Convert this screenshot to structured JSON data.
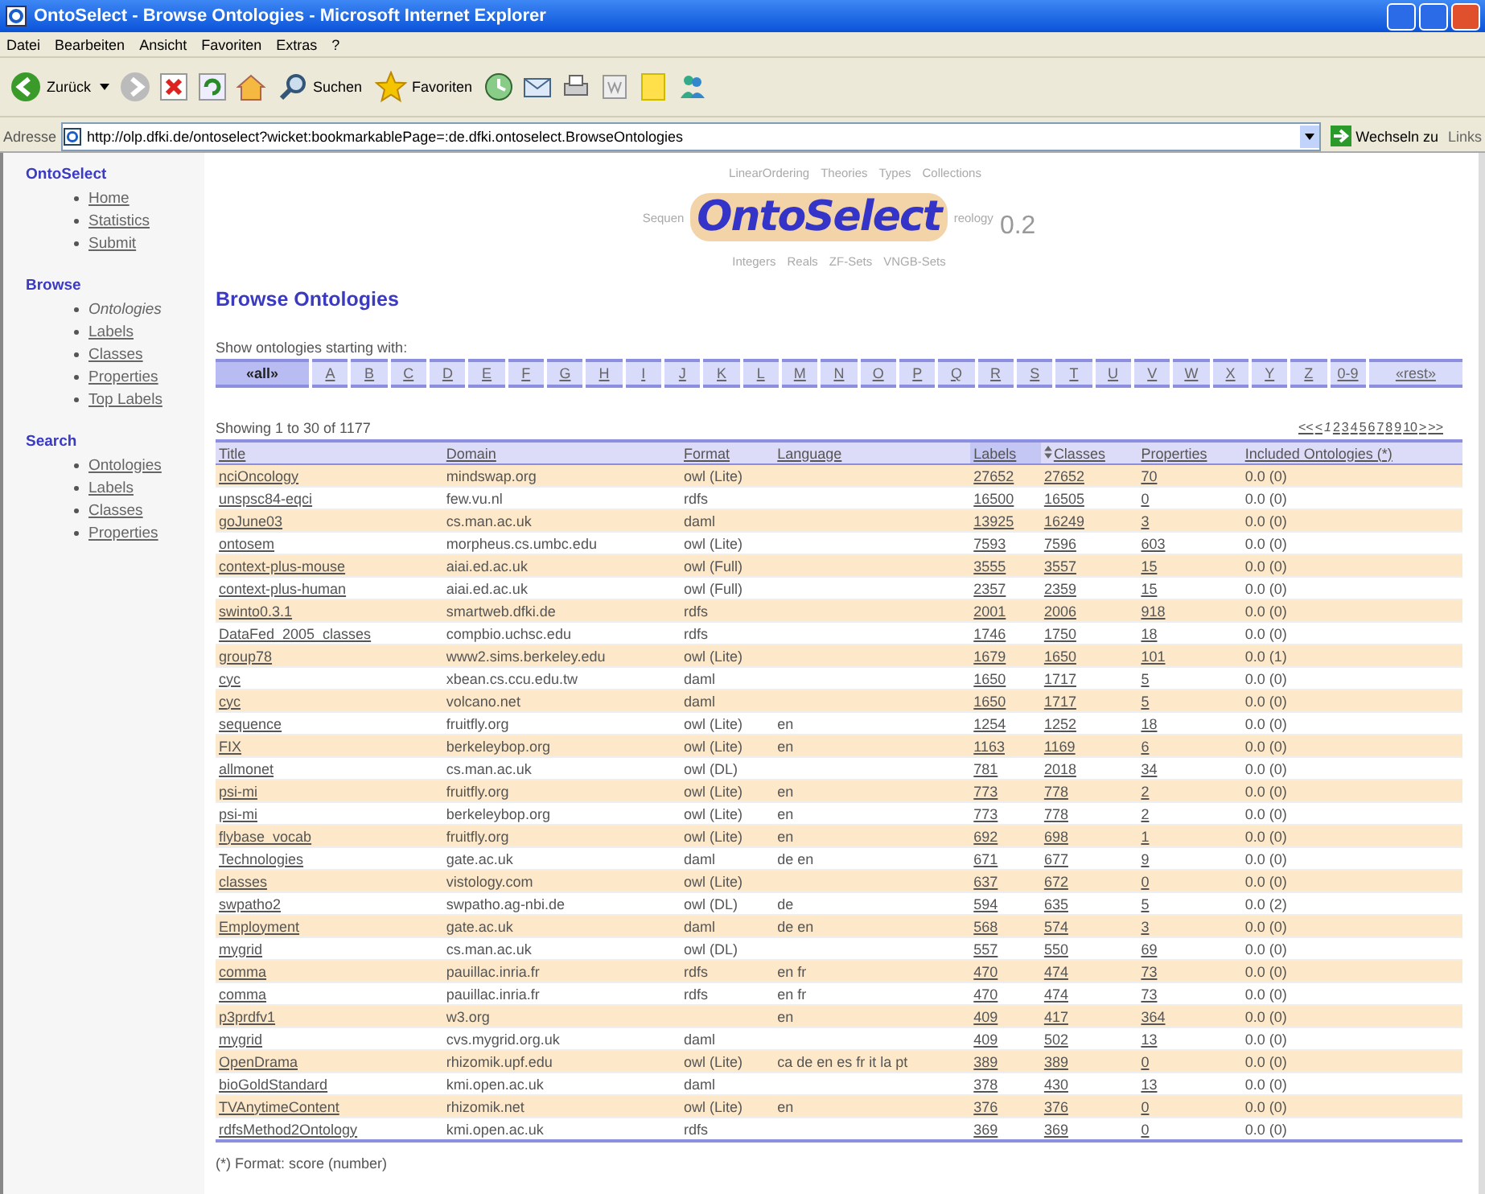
{
  "window": {
    "title": "OntoSelect - Browse Ontologies - Microsoft Internet Explorer"
  },
  "menu": [
    "Datei",
    "Bearbeiten",
    "Ansicht",
    "Favoriten",
    "Extras",
    "?"
  ],
  "toolbar": {
    "back": "Zurück",
    "search": "Suchen",
    "favorites": "Favoriten"
  },
  "address_bar": {
    "label": "Adresse",
    "url": "http://olp.dfki.de/ontoselect?wicket:bookmarkablePage=:de.dfki.ontoselect.BrowseOntologies",
    "go": "Wechseln zu",
    "links": "Links"
  },
  "sidebar": [
    {
      "heading": "OntoSelect",
      "items": [
        {
          "label": "Home",
          "selected": false
        },
        {
          "label": "Statistics",
          "selected": false
        },
        {
          "label": "Submit",
          "selected": false
        }
      ]
    },
    {
      "heading": "Browse",
      "items": [
        {
          "label": "Ontologies",
          "selected": true
        },
        {
          "label": "Labels",
          "selected": false
        },
        {
          "label": "Classes",
          "selected": false
        },
        {
          "label": "Properties",
          "selected": false
        },
        {
          "label": "Top Labels",
          "selected": false
        }
      ]
    },
    {
      "heading": "Search",
      "items": [
        {
          "label": "Ontologies",
          "selected": false
        },
        {
          "label": "Labels",
          "selected": false
        },
        {
          "label": "Classes",
          "selected": false
        },
        {
          "label": "Properties",
          "selected": false
        }
      ]
    }
  ],
  "logo": {
    "name": "OntoSelect",
    "version": "0.2",
    "words": [
      "LinearOrdering",
      "Theories",
      "Types",
      "Collections",
      "Sequen",
      "reology",
      "Integers",
      "Reals",
      "ZF-Sets",
      "VNGB-Sets"
    ]
  },
  "heading": "Browse Ontologies",
  "filter": {
    "label": "Show ontologies starting with:",
    "letters": [
      {
        "label": "«all»",
        "selected": true
      },
      {
        "label": "A",
        "selected": false
      },
      {
        "label": "B",
        "selected": false
      },
      {
        "label": "C",
        "selected": false
      },
      {
        "label": "D",
        "selected": false
      },
      {
        "label": "E",
        "selected": false
      },
      {
        "label": "F",
        "selected": false
      },
      {
        "label": "G",
        "selected": false
      },
      {
        "label": "H",
        "selected": false
      },
      {
        "label": "I",
        "selected": false
      },
      {
        "label": "J",
        "selected": false
      },
      {
        "label": "K",
        "selected": false
      },
      {
        "label": "L",
        "selected": false
      },
      {
        "label": "M",
        "selected": false
      },
      {
        "label": "N",
        "selected": false
      },
      {
        "label": "O",
        "selected": false
      },
      {
        "label": "P",
        "selected": false
      },
      {
        "label": "Q",
        "selected": false
      },
      {
        "label": "R",
        "selected": false
      },
      {
        "label": "S",
        "selected": false
      },
      {
        "label": "T",
        "selected": false
      },
      {
        "label": "U",
        "selected": false
      },
      {
        "label": "V",
        "selected": false
      },
      {
        "label": "W",
        "selected": false
      },
      {
        "label": "X",
        "selected": false
      },
      {
        "label": "Y",
        "selected": false
      },
      {
        "label": "Z",
        "selected": false
      },
      {
        "label": "0-9",
        "selected": false
      },
      {
        "label": "«rest»",
        "selected": false
      }
    ]
  },
  "showing": "Showing 1 to 30 of 1177",
  "pagination": [
    {
      "label": "<<",
      "selected": false
    },
    {
      "label": "<",
      "selected": false
    },
    {
      "label": "1",
      "selected": true
    },
    {
      "label": "2",
      "selected": false
    },
    {
      "label": "3",
      "selected": false
    },
    {
      "label": "4",
      "selected": false
    },
    {
      "label": "5",
      "selected": false
    },
    {
      "label": "6",
      "selected": false
    },
    {
      "label": "7",
      "selected": false
    },
    {
      "label": "8",
      "selected": false
    },
    {
      "label": "9",
      "selected": false
    },
    {
      "label": "10",
      "selected": false
    },
    {
      "label": ">",
      "selected": false
    },
    {
      "label": ">>",
      "selected": false
    }
  ],
  "table": {
    "columns": [
      {
        "label": "Title",
        "sorted": false,
        "sort_icon": false
      },
      {
        "label": "Domain",
        "sorted": false,
        "sort_icon": false
      },
      {
        "label": "Format",
        "sorted": false,
        "sort_icon": false
      },
      {
        "label": "Language",
        "sorted": false,
        "sort_icon": false
      },
      {
        "label": "Labels",
        "sorted": true,
        "sort_icon": false
      },
      {
        "label": "Classes",
        "sorted": false,
        "sort_icon": true
      },
      {
        "label": "Properties",
        "sorted": false,
        "sort_icon": false
      },
      {
        "label": "Included Ontologies (*)",
        "sorted": false,
        "sort_icon": false
      }
    ],
    "rows": [
      [
        "nciOncology",
        "mindswap.org",
        "owl (Lite)",
        "",
        "27652",
        "27652",
        "70",
        "0.0 (0)"
      ],
      [
        "unspsc84-eqci",
        "few.vu.nl",
        "rdfs",
        "",
        "16500",
        "16505",
        "0",
        "0.0 (0)"
      ],
      [
        "goJune03",
        "cs.man.ac.uk",
        "daml",
        "",
        "13925",
        "16249",
        "3",
        "0.0 (0)"
      ],
      [
        "ontosem",
        "morpheus.cs.umbc.edu",
        "owl (Lite)",
        "",
        "7593",
        "7596",
        "603",
        "0.0 (0)"
      ],
      [
        "context-plus-mouse",
        "aiai.ed.ac.uk",
        "owl (Full)",
        "",
        "3555",
        "3557",
        "15",
        "0.0 (0)"
      ],
      [
        "context-plus-human",
        "aiai.ed.ac.uk",
        "owl (Full)",
        "",
        "2357",
        "2359",
        "15",
        "0.0 (0)"
      ],
      [
        "swinto0.3.1",
        "smartweb.dfki.de",
        "rdfs",
        "",
        "2001",
        "2006",
        "918",
        "0.0 (0)"
      ],
      [
        "DataFed_2005_classes",
        "compbio.uchsc.edu",
        "rdfs",
        "",
        "1746",
        "1750",
        "18",
        "0.0 (0)"
      ],
      [
        "group78",
        "www2.sims.berkeley.edu",
        "owl (Lite)",
        "",
        "1679",
        "1650",
        "101",
        "0.0 (1)"
      ],
      [
        "cyc",
        "xbean.cs.ccu.edu.tw",
        "daml",
        "",
        "1650",
        "1717",
        "5",
        "0.0 (0)"
      ],
      [
        "cyc",
        "volcano.net",
        "daml",
        "",
        "1650",
        "1717",
        "5",
        "0.0 (0)"
      ],
      [
        "sequence",
        "fruitfly.org",
        "owl (Lite)",
        "en",
        "1254",
        "1252",
        "18",
        "0.0 (0)"
      ],
      [
        "FIX",
        "berkeleybop.org",
        "owl (Lite)",
        "en",
        "1163",
        "1169",
        "6",
        "0.0 (0)"
      ],
      [
        "allmonet",
        "cs.man.ac.uk",
        "owl (DL)",
        "",
        "781",
        "2018",
        "34",
        "0.0 (0)"
      ],
      [
        "psi-mi",
        "fruitfly.org",
        "owl (Lite)",
        "en",
        "773",
        "778",
        "2",
        "0.0 (0)"
      ],
      [
        "psi-mi",
        "berkeleybop.org",
        "owl (Lite)",
        "en",
        "773",
        "778",
        "2",
        "0.0 (0)"
      ],
      [
        "flybase_vocab",
        "fruitfly.org",
        "owl (Lite)",
        "en",
        "692",
        "698",
        "1",
        "0.0 (0)"
      ],
      [
        "Technologies",
        "gate.ac.uk",
        "daml",
        "de en",
        "671",
        "677",
        "9",
        "0.0 (0)"
      ],
      [
        "classes",
        "vistology.com",
        "owl (Lite)",
        "",
        "637",
        "672",
        "0",
        "0.0 (0)"
      ],
      [
        "swpatho2",
        "swpatho.ag-nbi.de",
        "owl (DL)",
        "de",
        "594",
        "635",
        "5",
        "0.0 (2)"
      ],
      [
        "Employment",
        "gate.ac.uk",
        "daml",
        "de en",
        "568",
        "574",
        "3",
        "0.0 (0)"
      ],
      [
        "mygrid",
        "cs.man.ac.uk",
        "owl (DL)",
        "",
        "557",
        "550",
        "69",
        "0.0 (0)"
      ],
      [
        "comma",
        "pauillac.inria.fr",
        "rdfs",
        "en fr",
        "470",
        "474",
        "73",
        "0.0 (0)"
      ],
      [
        "comma",
        "pauillac.inria.fr",
        "rdfs",
        "en fr",
        "470",
        "474",
        "73",
        "0.0 (0)"
      ],
      [
        "p3prdfv1",
        "w3.org",
        "",
        "en",
        "409",
        "417",
        "364",
        "0.0 (0)"
      ],
      [
        "mygrid",
        "cvs.mygrid.org.uk",
        "daml",
        "",
        "409",
        "502",
        "13",
        "0.0 (0)"
      ],
      [
        "OpenDrama",
        "rhizomik.upf.edu",
        "owl (Lite)",
        "ca de en es fr it la pt",
        "389",
        "389",
        "0",
        "0.0 (0)"
      ],
      [
        "bioGoldStandard",
        "kmi.open.ac.uk",
        "daml",
        "",
        "378",
        "430",
        "13",
        "0.0 (0)"
      ],
      [
        "TVAnytimeContent",
        "rhizomik.net",
        "owl (Lite)",
        "en",
        "376",
        "376",
        "0",
        "0.0 (0)"
      ],
      [
        "rdfsMethod2Ontology",
        "kmi.open.ac.uk",
        "rdfs",
        "",
        "369",
        "369",
        "0",
        "0.0 (0)"
      ]
    ]
  },
  "footnote": "(*) Format: score (number)"
}
